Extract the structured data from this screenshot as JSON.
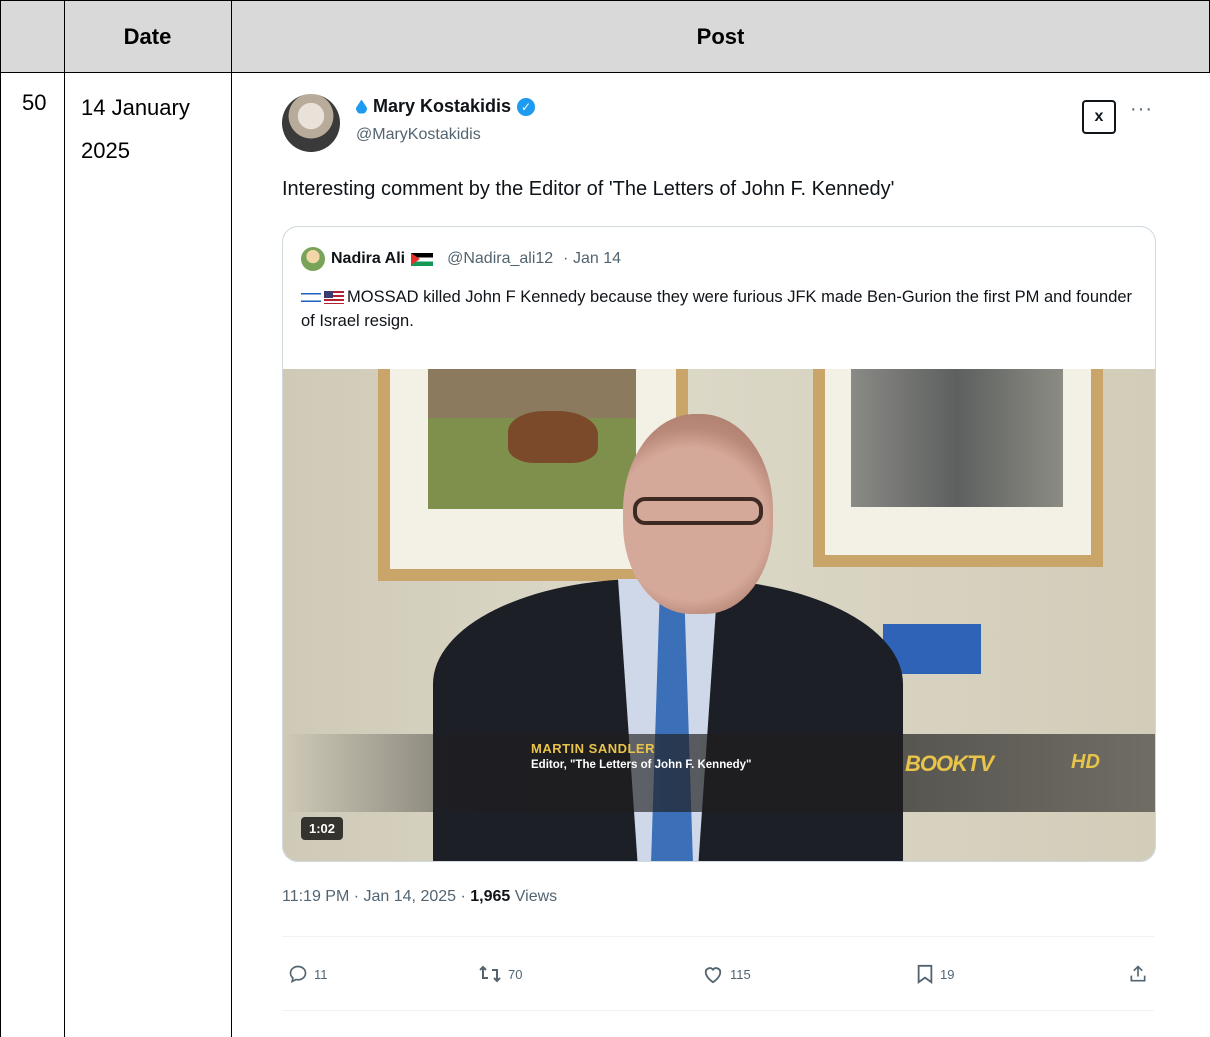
{
  "table": {
    "headers": [
      "",
      "Date",
      "Post"
    ],
    "row": {
      "number": "50",
      "date": "14 January 2025"
    }
  },
  "tweet": {
    "display_name": "Mary Kostakidis",
    "handle": "@MaryKostakidis",
    "text": "Interesting comment by the Editor of 'The Letters of John F. Kennedy'",
    "grok_label": "x",
    "more_label": "···",
    "quoted": {
      "display_name": "Nadira Ali",
      "handle": "@Nadira_ali12",
      "date": "· Jan 14",
      "text": "MOSSAD killed John F Kennedy because they were furious JFK made Ben-Gurion the first PM and founder of Israel resign."
    },
    "video": {
      "lower_third_name": "MARTIN SANDLER",
      "lower_third_title": "Editor, \"The Letters of John F. Kennedy\"",
      "channel": "BOOKTV",
      "hd": "HD",
      "duration": "1:02"
    },
    "timestamp": "11:19 PM · Jan 14, 2025 · ",
    "views_count": "1,965",
    "views_label": " Views",
    "actions": {
      "replies": "11",
      "reposts": "70",
      "likes": "115",
      "bookmarks": "19"
    },
    "icons": [
      "reply-icon",
      "repost-icon",
      "like-icon",
      "bookmark-icon",
      "share-icon"
    ]
  }
}
